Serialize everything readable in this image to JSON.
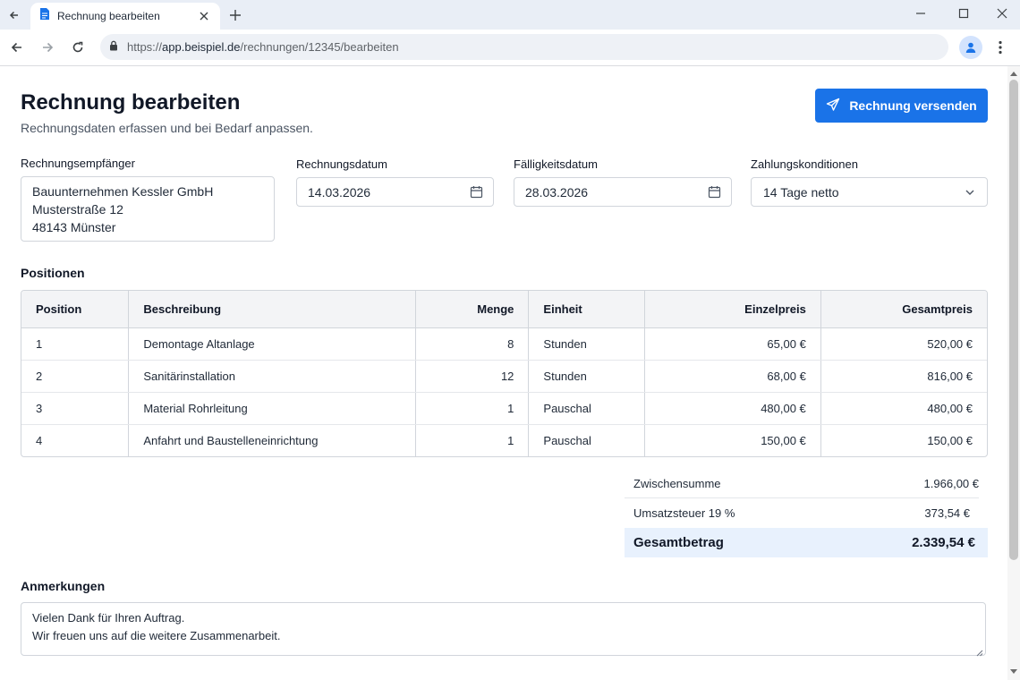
{
  "browser": {
    "tab_title": "Rechnung bearbeiten",
    "url_scheme": "https://",
    "url_host": "app.beispiel.de",
    "url_path": "/rechnungen/12345/bearbeiten"
  },
  "header": {
    "title": "Rechnung bearbeiten",
    "subtitle": "Rechnungsdaten erfassen und bei Bedarf anpassen.",
    "send_button_label": "Rechnung versenden"
  },
  "form": {
    "recipient_label": "Rechnungsempfänger",
    "recipient_lines": [
      "Bauunternehmen Kessler GmbH",
      "Musterstraße 12",
      "48143 Münster"
    ],
    "invoice_date_label": "Rechnungsdatum",
    "invoice_date_value": "14.03.2026",
    "due_date_label": "Fälligkeitsdatum",
    "due_date_value": "28.03.2026",
    "payment_terms_label": "Zahlungskonditionen",
    "payment_terms_value": "14 Tage netto"
  },
  "positions": {
    "section_title": "Positionen",
    "columns": [
      "Position",
      "Beschreibung",
      "Menge",
      "Einheit",
      "Einzelpreis",
      "Gesamtpreis"
    ],
    "rows": [
      {
        "pos": "1",
        "desc": "Demontage Altanlage",
        "qty": "8",
        "unit": "Stunden",
        "unit_price": "65,00 €",
        "total": "520,00 €"
      },
      {
        "pos": "2",
        "desc": "Sanitärinstallation",
        "qty": "12",
        "unit": "Stunden",
        "unit_price": "68,00 €",
        "total": "816,00 €"
      },
      {
        "pos": "3",
        "desc": "Material Rohrleitung",
        "qty": "1",
        "unit": "Pauschal",
        "unit_price": "480,00 €",
        "total": "480,00 €"
      },
      {
        "pos": "4",
        "desc": "Anfahrt und Baustelleneinrichtung",
        "qty": "1",
        "unit": "Pauschal",
        "unit_price": "150,00 €",
        "total": "150,00 €"
      }
    ]
  },
  "totals": {
    "subtotal_label": "Zwischensumme",
    "subtotal_value": "1.966,00 €",
    "vat_label": "Umsatzsteuer 19 %",
    "vat_value": "373,54 €",
    "grand_label": "Gesamtbetrag",
    "grand_value": "2.339,54 €"
  },
  "notes": {
    "label": "Anmerkungen",
    "lines": [
      "Vielen Dank für Ihren Auftrag.",
      "Wir freuen uns auf die weitere Zusammenarbeit."
    ]
  },
  "colors": {
    "primary": "#1a73e8",
    "grand_total_bg": "#e8f1fd",
    "table_header_bg": "#f3f4f6"
  },
  "icons": {
    "send_button": "paper-plane-icon",
    "date_fields": "calendar-icon",
    "payment_terms": "chevron-down-icon",
    "tab": "document-icon",
    "address_bar": "lock-icon",
    "profile": "person-icon"
  }
}
